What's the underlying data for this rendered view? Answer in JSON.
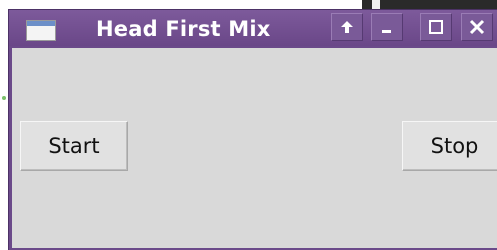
{
  "window": {
    "title": "Head First Mix",
    "controls": {
      "raise_icon": "up-arrow-icon",
      "minimize_icon": "minimize-icon",
      "maximize_icon": "maximize-icon",
      "close_icon": "close-icon"
    },
    "colors": {
      "titlebar": "#6b4a8a",
      "content": "#d9d9d9"
    }
  },
  "buttons": {
    "start_label": "Start",
    "stop_label": "Stop"
  }
}
